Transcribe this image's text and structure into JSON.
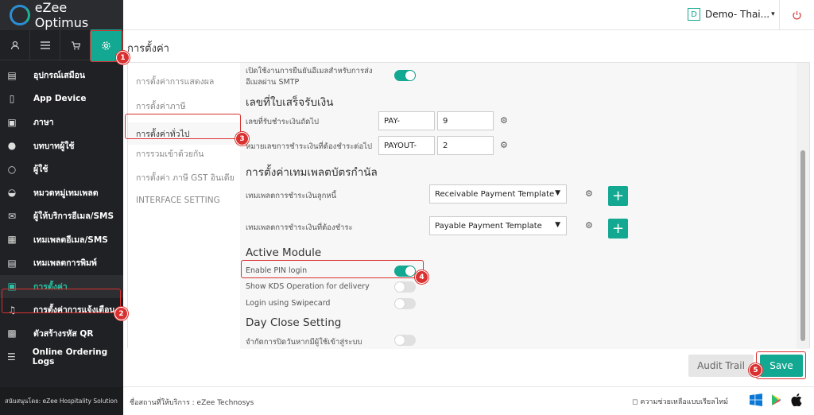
{
  "app": {
    "logo_text": "eZee Optimus"
  },
  "header": {
    "property": "Demo- Thai...",
    "property_badge": "D",
    "caret": "▾"
  },
  "sidebar": {
    "items": [
      {
        "label": "อุปกรณ์เสมือน",
        "icon": "terminal-icon"
      },
      {
        "label": "App Device",
        "icon": "tablet-icon"
      },
      {
        "label": "ภาษา",
        "icon": "language-icon"
      },
      {
        "label": "บทบาทผู้ใช้",
        "icon": "user-role-icon"
      },
      {
        "label": "ผู้ใช้",
        "icon": "user-icon"
      },
      {
        "label": "หมวดหมู่เทมเพลต",
        "icon": "inbox-icon"
      },
      {
        "label": "ผู้ให้บริการอีเมล/SMS",
        "icon": "mail-icon"
      },
      {
        "label": "เทมเพลตอีเมล/SMS",
        "icon": "calendar-icon"
      },
      {
        "label": "เทมเพลตการพิมพ์",
        "icon": "print-template-icon"
      },
      {
        "label": "การตั้งค่า",
        "icon": "settings-icon"
      },
      {
        "label": "การตั้งค่าการแจ้งเตือน",
        "icon": "bell-icon"
      },
      {
        "label": "ตัวสร้างรหัส QR",
        "icon": "qr-icon"
      },
      {
        "label": "Online Ordering Logs",
        "icon": "list-icon"
      }
    ],
    "footer": "สนับสนุนโดย: eZee Hospitality Solution"
  },
  "page_title": "การตั้งค่า",
  "tabs": [
    "การตั้งค่าการแสดงผล",
    "การตั้งค่าภาษี",
    "การตั้งค่าทั่วไป",
    "การรวมเข้าด้วยกัน",
    "การตั้งค่า ภาษี GST อินเดีย",
    "INTERFACE SETTING"
  ],
  "content": {
    "smtp_label_1": "เปิดใช้งานการยืนยันอีเมลสำหรับการส่ง",
    "smtp_label_2": "อีเมลผ่าน SMTP",
    "receipt_section": "เลขที่ใบเสร็จรับเงิน",
    "next_receipt_label": "เลขที่รับชำระเงินถัดไป",
    "next_receipt_prefix": "PAY-",
    "next_receipt_number": "9",
    "next_payout_label": "หมายเลขการชำระเงินที่ต้องชำระต่อไป",
    "next_payout_prefix": "PAYOUT-",
    "next_payout_number": "2",
    "template_section": "การตั้งค่าเทมเพลตบัตรกำนัล",
    "receivable_label": "เทมเพลตการชำระเงินลูกหนี้",
    "receivable_value": "Receivable Payment Template",
    "payable_label": "เทมเพลตการชำระเงินที่ต้องชำระ",
    "payable_value": "Payable Payment Template",
    "active_module": "Active Module",
    "enable_pin": "Enable PIN login",
    "show_kds": "Show KDS Operation for delivery",
    "login_swipe": "Login using Swipecard",
    "day_close": "Day Close Setting",
    "day_close_label": "จำกัดการปิดวันหากมีผู้ใช้เข้าสู่ระบบ"
  },
  "buttons": {
    "audit": "Audit Trail",
    "save": "Save"
  },
  "bottombar": {
    "provider": "ชื่อสถานที่ให้บริการ : eZee Technosys",
    "help": "ความช่วยเหลือแบบเรียลไทม์"
  },
  "annotations": [
    "1",
    "2",
    "3",
    "4",
    "5"
  ],
  "colors": {
    "accent": "#12a891",
    "annotation": "#d93030",
    "sidebar": "#1f2124"
  }
}
